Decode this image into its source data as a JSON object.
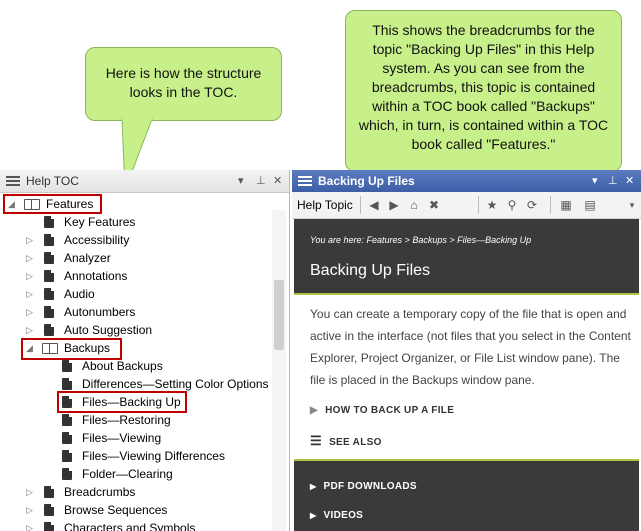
{
  "callouts": {
    "left": "Here is how the structure looks in the TOC.",
    "right": "This shows the breadcrumbs for the topic \"Backing Up Files\" in this Help system. As you can see from the breadcrumbs, this topic is contained within a TOC book called \"Backups\" which, in turn, is contained within a TOC book called \"Features.\""
  },
  "toc_pane": {
    "title": "Help TOC",
    "pin_icon": "pin-icon",
    "close_icon": "close-icon",
    "items": [
      {
        "label": "Features",
        "type": "book",
        "expanded": true
      },
      {
        "label": "Key Features",
        "type": "page"
      },
      {
        "label": "Accessibility",
        "type": "book"
      },
      {
        "label": "Analyzer",
        "type": "book"
      },
      {
        "label": "Annotations",
        "type": "book"
      },
      {
        "label": "Audio",
        "type": "book"
      },
      {
        "label": "Autonumbers",
        "type": "book"
      },
      {
        "label": "Auto Suggestion",
        "type": "book"
      },
      {
        "label": "Backups",
        "type": "book",
        "expanded": true
      },
      {
        "label": "About Backups",
        "type": "page"
      },
      {
        "label": "Differences—Setting Color Options",
        "type": "page"
      },
      {
        "label": "Files—Backing Up",
        "type": "page",
        "selected": true
      },
      {
        "label": "Files—Restoring",
        "type": "page"
      },
      {
        "label": "Files—Viewing",
        "type": "page"
      },
      {
        "label": "Files—Viewing Differences",
        "type": "page"
      },
      {
        "label": "Folder—Clearing",
        "type": "page"
      },
      {
        "label": "Breadcrumbs",
        "type": "book"
      },
      {
        "label": "Browse Sequences",
        "type": "book"
      },
      {
        "label": "Characters and Symbols",
        "type": "book"
      }
    ]
  },
  "topic_pane": {
    "title": "Backing Up Files",
    "toolbar_label": "Help Topic",
    "breadcrumbs": "You are here: Features > Backups > Files—Backing Up",
    "topic_title": "Backing Up Files",
    "body": "You can create a temporary copy of the file that is open and active in the interface (not files that you select in the Content Explorer, Project Organizer, or File List window pane). The file is placed in the Backups window pane.",
    "dropdowns": [
      "HOW TO BACK UP A FILE",
      "SEE ALSO"
    ],
    "bottom_items": [
      "PDF DOWNLOADS",
      "VIDEOS"
    ],
    "colors": {
      "header": "#3d5ea6",
      "dark": "#3a3a3a",
      "accent": "#a8c544"
    }
  }
}
